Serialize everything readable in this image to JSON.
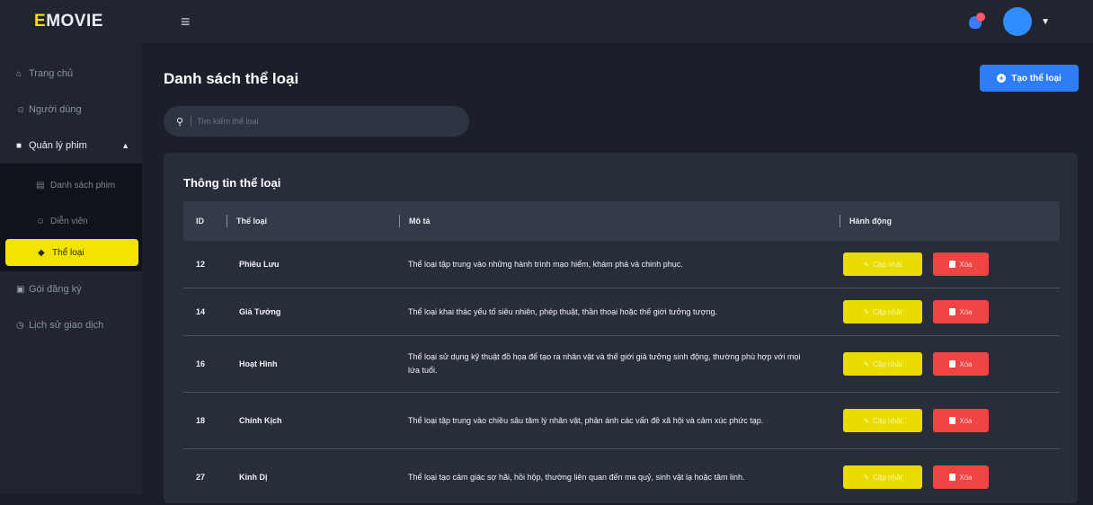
{
  "brand": {
    "first": "E",
    "rest": "MOVIE"
  },
  "colors": {
    "accent": "#f2e400",
    "primary": "#2f7df6",
    "danger": "#ef4444"
  },
  "sidebar": {
    "items": [
      {
        "label": "Trang chủ",
        "icon": "home-icon"
      },
      {
        "label": "Người dùng",
        "icon": "user-icon"
      },
      {
        "label": "Quản lý phim",
        "icon": "film-icon",
        "expanded": true,
        "children": [
          {
            "label": "Danh sách phim",
            "icon": "list-icon"
          },
          {
            "label": "Diễn viên",
            "icon": "actor-icon"
          },
          {
            "label": "Thể loại",
            "icon": "tag-icon",
            "active": true
          }
        ]
      },
      {
        "label": "Gói đăng ký",
        "icon": "package-icon"
      },
      {
        "label": "Lịch sử giao dịch",
        "icon": "history-icon"
      }
    ]
  },
  "header": {
    "page_title": "Danh sách thể loại",
    "create_label": "Tạo thể loại"
  },
  "search": {
    "placeholder": "Tìm kiếm thể loại"
  },
  "card": {
    "title": "Thông tin thể loại"
  },
  "table": {
    "columns": [
      "ID",
      "Thể loại",
      "Mô tả",
      "Hành động"
    ],
    "edit_label": "Cập nhật",
    "delete_label": "Xóa",
    "rows": [
      {
        "id": "12",
        "name": "Phiêu Lưu",
        "desc": "Thể loại tập trung vào những hành trình mạo hiểm, khám phá và chinh phục."
      },
      {
        "id": "14",
        "name": "Giả Tưởng",
        "desc": "Thể loại khai thác yếu tố siêu nhiên, phép thuật, thần thoại hoặc thế giới tưởng tượng."
      },
      {
        "id": "16",
        "name": "Hoạt Hình",
        "desc": "Thể loại sử dụng kỹ thuật đồ họa để tạo ra nhân vật và thế giới giả tưởng sinh động, thường phù hợp với mọi lứa tuổi."
      },
      {
        "id": "18",
        "name": "Chính Kịch",
        "desc": "Thể loại tập trung vào chiều sâu tâm lý nhân vật, phản ánh các vấn đề xã hội và cảm xúc phức tạp."
      },
      {
        "id": "27",
        "name": "Kinh Dị",
        "desc": "Thể loại tạo cảm giác sợ hãi, hồi hộp, thường liên quan đến ma quỷ, sinh vật lạ hoặc tâm linh."
      }
    ]
  }
}
